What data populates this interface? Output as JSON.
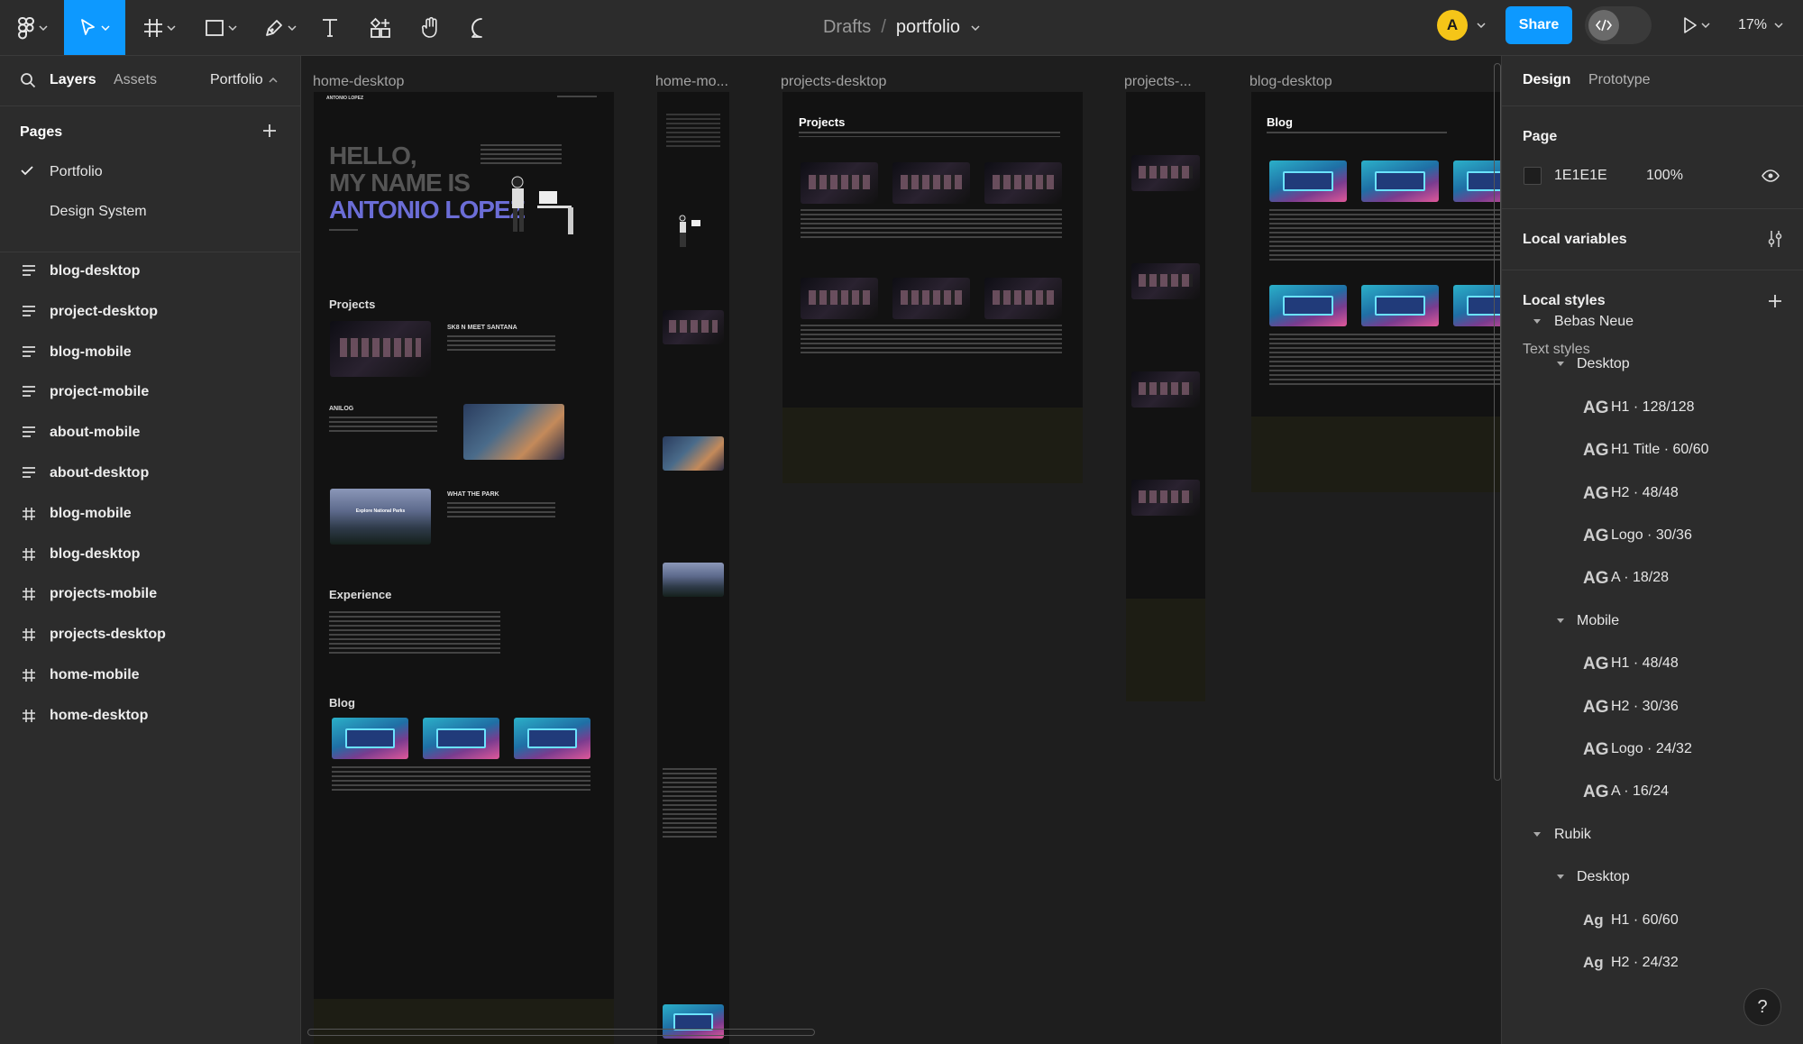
{
  "toolbar": {
    "breadcrumb_drafts": "Drafts",
    "breadcrumb_sep": "/",
    "file_name": "portfolio",
    "avatar_initial": "A",
    "share_label": "Share",
    "zoom": "17%",
    "tools": [
      "main-menu",
      "move",
      "frame",
      "shape",
      "pen",
      "text",
      "components",
      "hand",
      "comment"
    ]
  },
  "left_panel": {
    "tab_layers": "Layers",
    "tab_assets": "Assets",
    "page_selector": "Portfolio",
    "pages_header": "Pages",
    "pages": [
      {
        "label": "Portfolio",
        "selected": true
      },
      {
        "label": "Design System",
        "selected": false
      }
    ],
    "layers": [
      {
        "label": "blog-desktop",
        "icon": "section-icon"
      },
      {
        "label": "project-desktop",
        "icon": "section-icon"
      },
      {
        "label": "blog-mobile",
        "icon": "section-icon"
      },
      {
        "label": "project-mobile",
        "icon": "section-icon"
      },
      {
        "label": "about-mobile",
        "icon": "section-icon"
      },
      {
        "label": "about-desktop",
        "icon": "section-icon"
      },
      {
        "label": "blog-mobile",
        "icon": "frame-icon"
      },
      {
        "label": "blog-desktop",
        "icon": "frame-icon"
      },
      {
        "label": "projects-mobile",
        "icon": "frame-icon"
      },
      {
        "label": "projects-desktop",
        "icon": "frame-icon"
      },
      {
        "label": "home-mobile",
        "icon": "frame-icon"
      },
      {
        "label": "home-desktop",
        "icon": "frame-icon"
      }
    ]
  },
  "canvas": {
    "frames": [
      {
        "label": "home-desktop"
      },
      {
        "label": "home-mo..."
      },
      {
        "label": "projects-desktop"
      },
      {
        "label": "projects-..."
      },
      {
        "label": "blog-desktop"
      }
    ],
    "home": {
      "logo": "ANTONIO LOPEZ",
      "hero_line1": "HELLO,",
      "hero_line2": "MY NAME IS",
      "hero_line3": "ANTONIO LOPEZ",
      "projects": "Projects",
      "p1": "SK8 N MEET SANTANA",
      "p2": "ANILOG",
      "p3": "WHAT THE PARK",
      "park_thumb": "Explore National Parks",
      "experience": "Experience",
      "blog": "Blog"
    },
    "projects_title": "Projects",
    "blog_title": "Blog"
  },
  "right_panel": {
    "tab_design": "Design",
    "tab_prototype": "Prototype",
    "page_header": "Page",
    "bg_hex": "1E1E1E",
    "bg_opacity": "100%",
    "local_variables": "Local variables",
    "local_styles": "Local styles",
    "text_styles": "Text styles",
    "ag_glyph": "AG",
    "ag_glyph_rubik": "Ag",
    "groups": [
      {
        "label": "Bebas Neue",
        "level": 0
      },
      {
        "label": "Desktop",
        "level": 1
      },
      {
        "style": "H1 · 128/128"
      },
      {
        "style": "H1 Title · 60/60"
      },
      {
        "style": "H2 · 48/48"
      },
      {
        "style": "Logo · 30/36"
      },
      {
        "style": "A · 18/28"
      },
      {
        "label": "Mobile",
        "level": 1
      },
      {
        "style": "H1 · 48/48"
      },
      {
        "style": "H2 · 30/36"
      },
      {
        "style": "Logo · 24/32"
      },
      {
        "style": "A · 16/24"
      },
      {
        "label": "Rubik",
        "level": 0
      },
      {
        "label": "Desktop",
        "level": 1
      },
      {
        "style": "H1 · 60/60"
      },
      {
        "style": "H2 · 24/32"
      }
    ],
    "help": "?"
  },
  "colors": {
    "accent": "#0d99ff",
    "panel": "#2c2c2c",
    "canvas": "#1e1e1e",
    "avatar": "#f5c518",
    "hero_accent": "#6b6dd6"
  }
}
